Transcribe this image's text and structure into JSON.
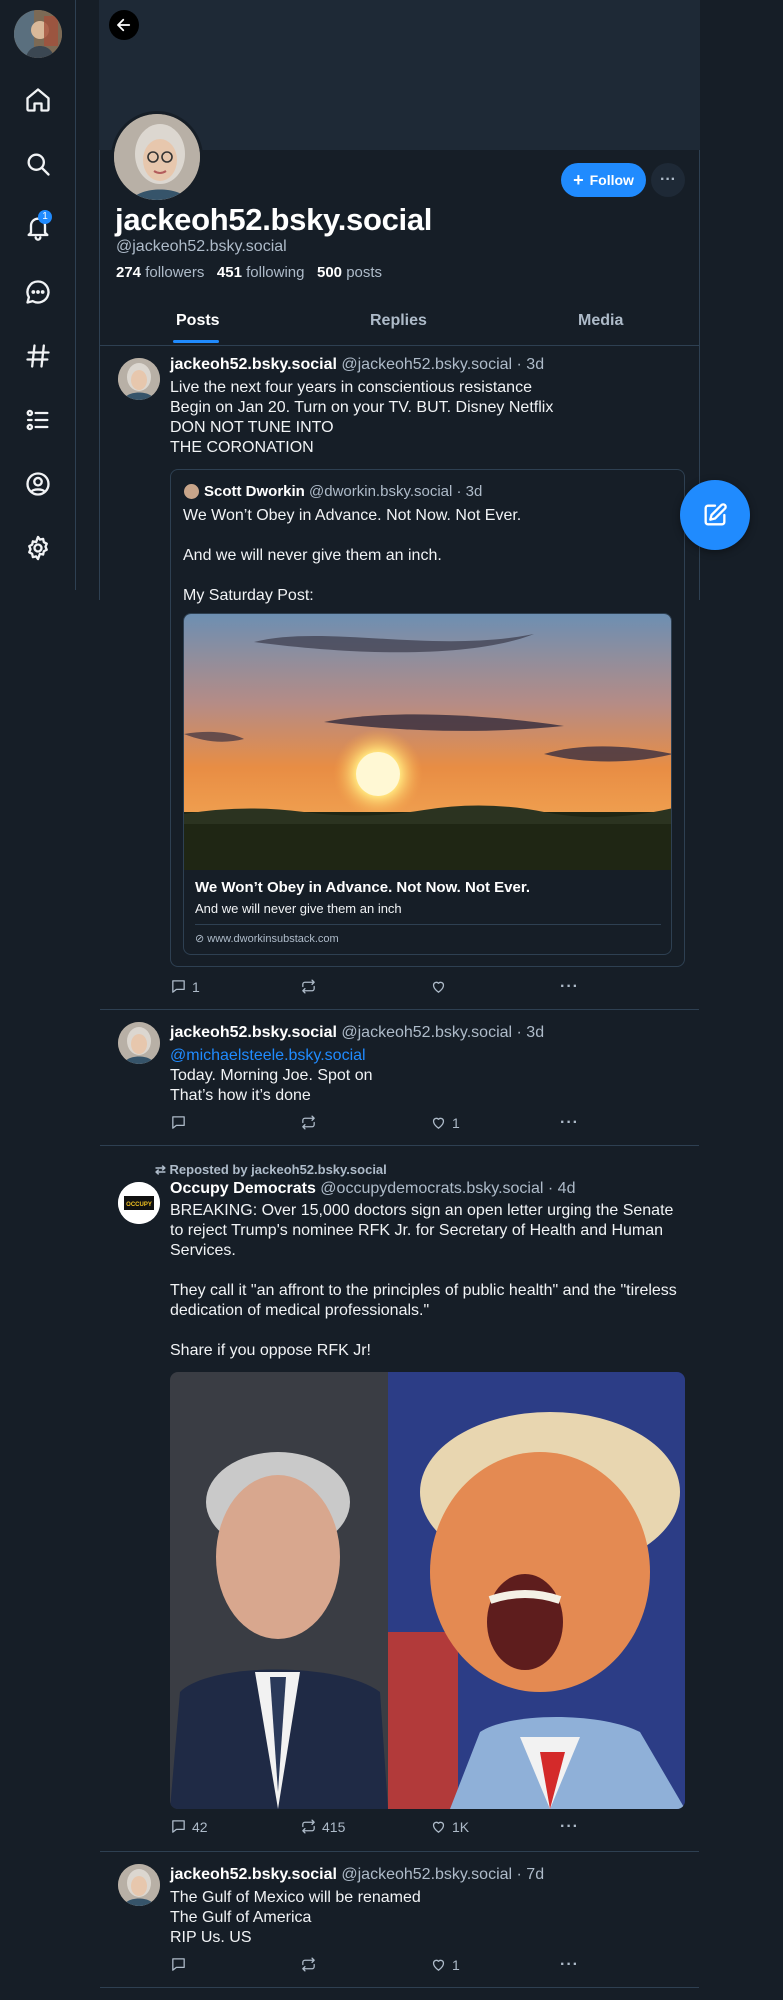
{
  "colors": {
    "background": "#161e27",
    "accent": "#208bfe",
    "muted": "#aebbc9",
    "border": "#2e4052"
  },
  "sidebar": {
    "notification_count": "1",
    "items": [
      {
        "icon": "home-icon"
      },
      {
        "icon": "search-icon"
      },
      {
        "icon": "bell-icon"
      },
      {
        "icon": "chat-icon"
      },
      {
        "icon": "hashtag-icon"
      },
      {
        "icon": "lists-icon"
      },
      {
        "icon": "profile-icon"
      },
      {
        "icon": "gear-icon"
      }
    ]
  },
  "profile": {
    "display_name": "jackeoh52.bsky.social",
    "handle": "@jackeoh52.bsky.social",
    "followers_count": "274",
    "followers_label": "followers",
    "following_count": "451",
    "following_label": "following",
    "posts_count": "500",
    "posts_label": "posts",
    "follow_label": "Follow",
    "more_label": "···"
  },
  "tabs": [
    {
      "label": "Posts",
      "active": true
    },
    {
      "label": "Replies",
      "active": false
    },
    {
      "label": "Media",
      "active": false
    }
  ],
  "posts": [
    {
      "author": "jackeoh52.bsky.social",
      "handle": "@jackeoh52.bsky.social",
      "time": "· 3d",
      "text": "Live the next four years in conscientious resistance\nBegin on Jan 20. Turn on your TV.  BUT. Disney Netflix\nDON NOT TUNE INTO\nTHE CORONATION",
      "quote": {
        "author": "Scott Dworkin",
        "handle": "@dworkin.bsky.social",
        "time": "· 3d",
        "text": "We Won’t Obey in Advance. Not Now. Not Ever.\n\nAnd we will never give them an inch.\n\nMy Saturday Post:",
        "link_title": "We Won’t Obey in Advance. Not Now. Not Ever.",
        "link_description": "And we will never give them an inch",
        "link_domain": "www.dworkinsubstack.com"
      },
      "replies": "1",
      "reposts": "",
      "likes": ""
    },
    {
      "author": "jackeoh52.bsky.social",
      "handle": "@jackeoh52.bsky.social",
      "time": "· 3d",
      "mention": "@michaelsteele.bsky.social",
      "text": "Today. Morning Joe. Spot on\nThat’s how it’s done",
      "replies": "",
      "reposts": "",
      "likes": "1"
    },
    {
      "repost_label": "Reposted by jackeoh52.bsky.social",
      "author": "Occupy Democrats",
      "handle": "@occupydemocrats.bsky.social",
      "time": "· 4d",
      "avatar_text": "OCCUPY",
      "text": "BREAKING: Over 15,000 doctors sign an open letter urging the Senate to reject Trump's nominee RFK Jr. for Secretary of Health and Human Services.\n\nThey call it \"an affront to the principles of public health\" and the \"tireless dedication of medical professionals.\"\n\nShare if you oppose RFK Jr!",
      "replies": "42",
      "reposts": "415",
      "likes": "1K"
    },
    {
      "author": "jackeoh52.bsky.social",
      "handle": "@jackeoh52.bsky.social",
      "time": "· 7d",
      "text": "The Gulf of Mexico will be renamed\nThe Gulf of America\nRIP Us. US",
      "replies": "",
      "reposts": "",
      "likes": "1"
    }
  ]
}
